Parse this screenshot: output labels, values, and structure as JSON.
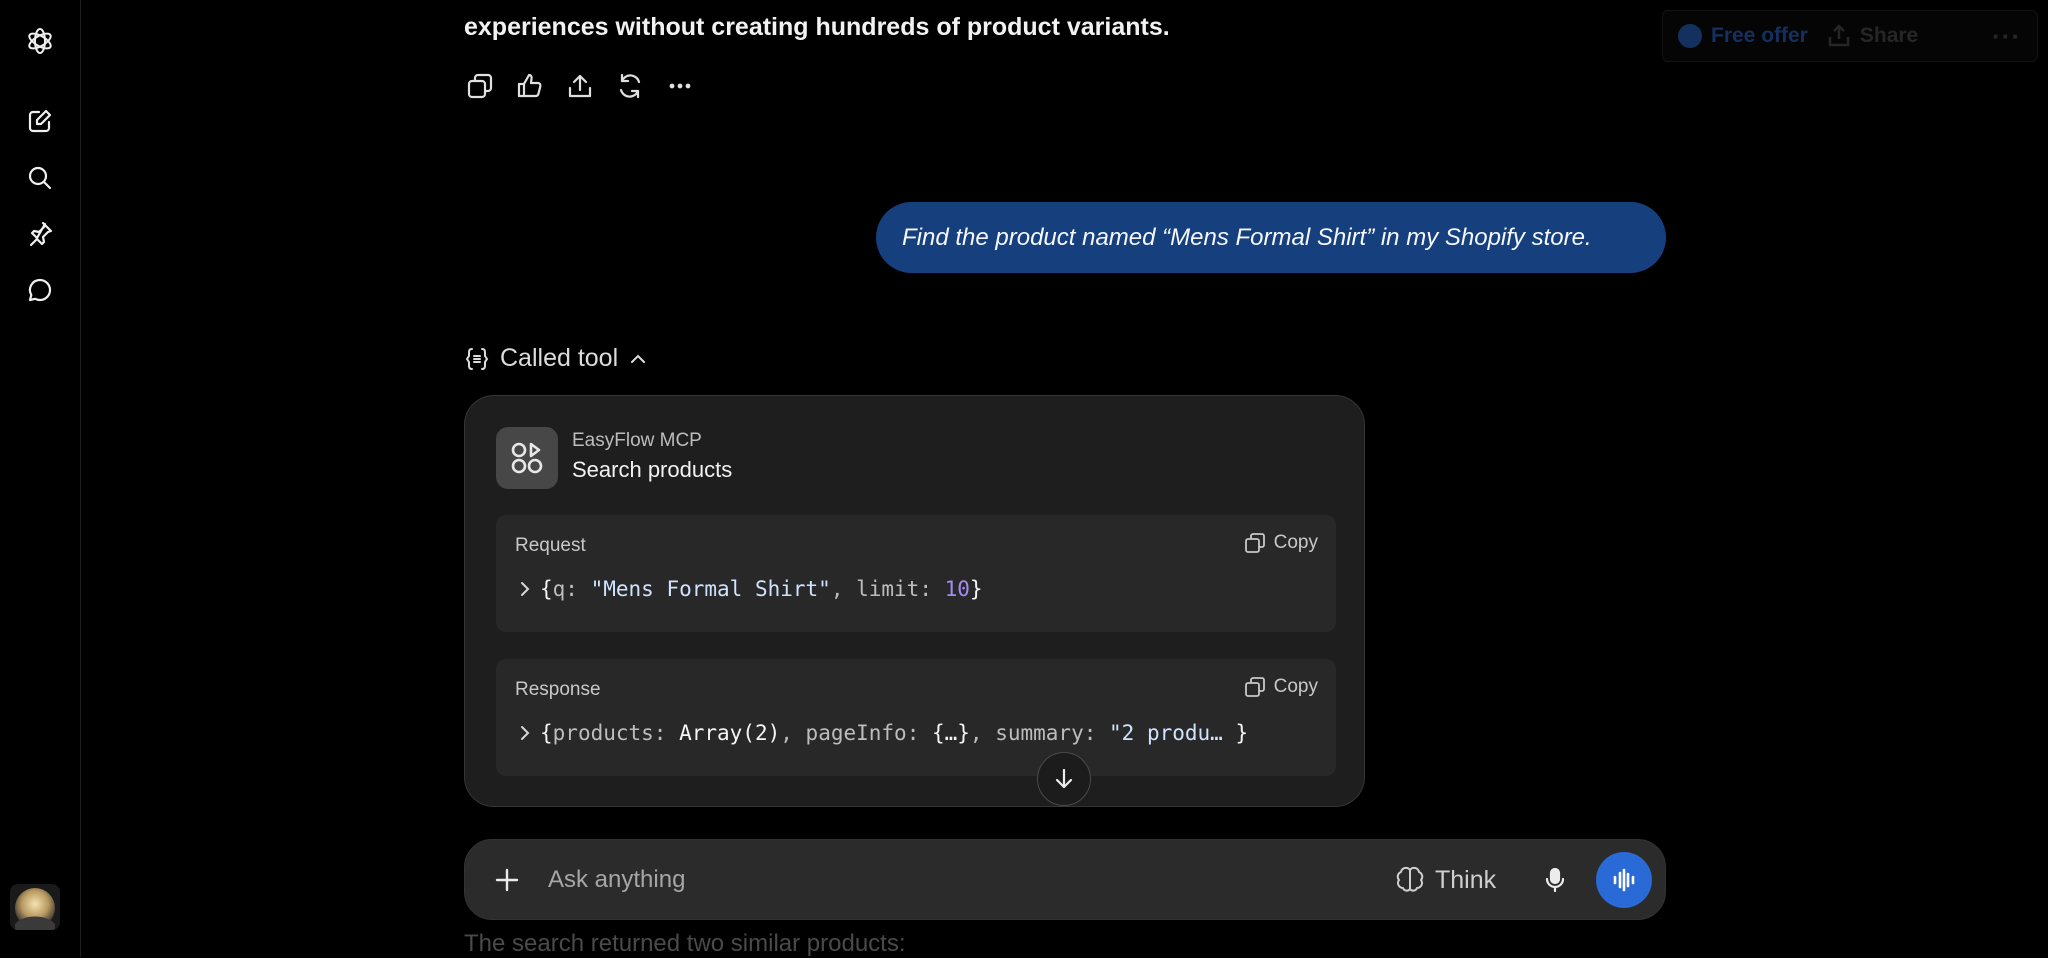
{
  "header": {
    "offer_label": "Free offer",
    "share_label": "Share",
    "more_label": "···"
  },
  "conversation": {
    "assistant_text_prev": "experiences without creating hundreds of product variants.",
    "user_message": "Find the product named “Mens Formal Shirt” in my Shopify store.",
    "called_tool_label": "Called tool",
    "tool": {
      "provider": "EasyFlow MCP",
      "name": "Search products",
      "request": {
        "title": "Request",
        "copy_label": "Copy",
        "open_brace": "{",
        "key1": "q: ",
        "val1": "\"Mens Formal Shirt\"",
        "sep1": ", ",
        "key2": "limit: ",
        "val2": "10",
        "close_brace": "}"
      },
      "response": {
        "title": "Response",
        "copy_label": "Copy",
        "open_brace": "{",
        "key1": "products: ",
        "val1": "Array(2)",
        "sep1": ", ",
        "key2": "pageInfo: ",
        "val2": "{…}",
        "sep2": ", ",
        "key3": "summary: ",
        "val3": "\"2 produ…",
        "close_brace": " }"
      }
    },
    "following_text": "The search returned two similar products:"
  },
  "composer": {
    "placeholder": "Ask anything",
    "think_label": "Think"
  },
  "colors": {
    "background": "#000000",
    "user_bubble": "#163f7e",
    "voice_button": "#2a6ad6",
    "tool_card": "#1e1e1e"
  }
}
